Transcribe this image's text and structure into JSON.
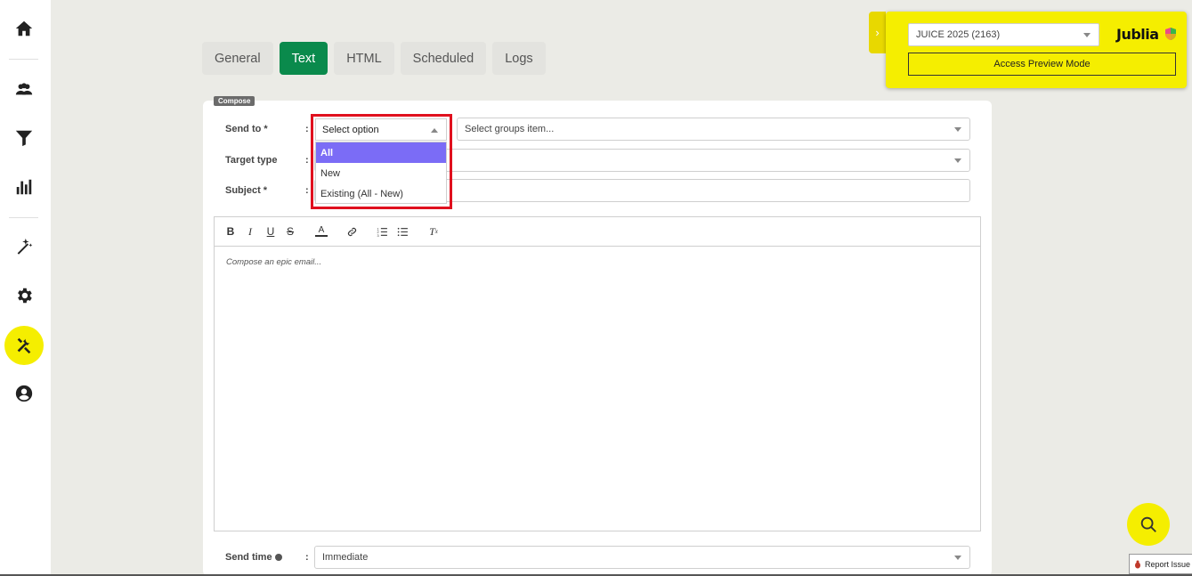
{
  "tabs": [
    {
      "label": "General"
    },
    {
      "label": "Text"
    },
    {
      "label": "HTML"
    },
    {
      "label": "Scheduled"
    },
    {
      "label": "Logs"
    }
  ],
  "active_tab": "Text",
  "compose_badge": "Compose",
  "form": {
    "send_to_label": "Send to *",
    "colon": ":",
    "send_to_value": "Select option",
    "groups_placeholder": "Select groups item...",
    "target_type_label": "Target type",
    "target_type_value": "",
    "subject_label": "Subject *",
    "subject_value": "",
    "send_time_label": "Send time",
    "send_time_value": "Immediate"
  },
  "dropdown": {
    "options": [
      {
        "label": "All"
      },
      {
        "label": "New"
      },
      {
        "label": "Existing (All - New)"
      }
    ],
    "selected": "All"
  },
  "editor": {
    "placeholder": "Compose an epic email...",
    "toolbar": [
      "bold",
      "italic",
      "underline",
      "strikethrough",
      "text-color",
      "link",
      "ordered-list",
      "bullet-list",
      "clear-format"
    ]
  },
  "widget": {
    "event_select": "JUICE 2025 (2163)",
    "brand": "Jublia",
    "preview_button": "Access Preview Mode"
  },
  "report_issue": "Report Issue",
  "colors": {
    "accent_green": "#0a8a4c",
    "highlight_yellow": "#f5ee00",
    "selected_option": "#7b6cf6",
    "annotation_red": "#e0101e"
  }
}
